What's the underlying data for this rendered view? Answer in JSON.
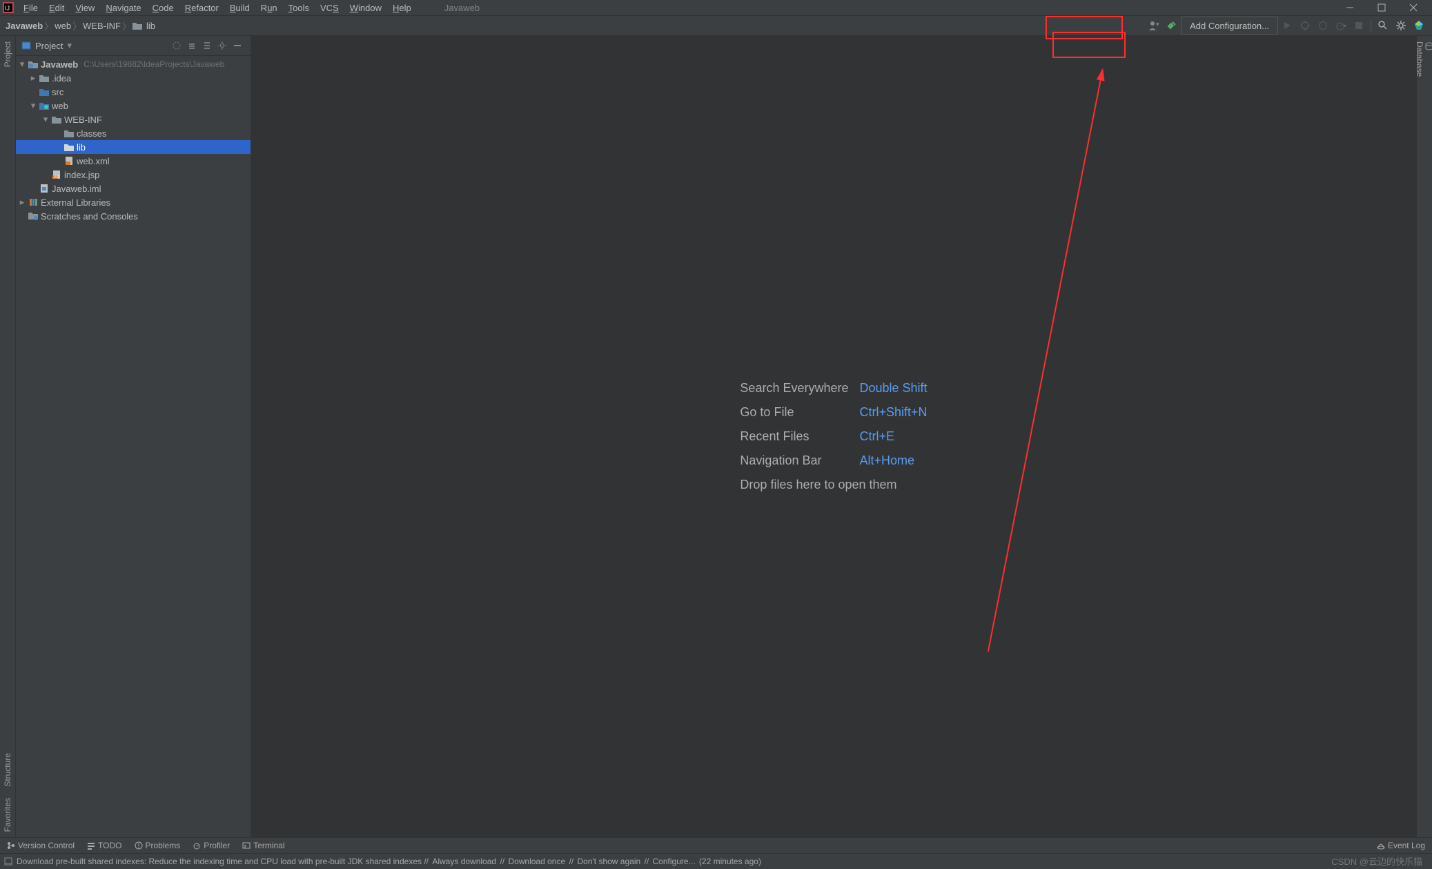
{
  "title": {
    "project": "Javaweb"
  },
  "menu": [
    "File",
    "Edit",
    "View",
    "Navigate",
    "Code",
    "Refactor",
    "Build",
    "Run",
    "Tools",
    "VCS",
    "Window",
    "Help"
  ],
  "breadcrumbs": {
    "items": [
      "Javaweb",
      "web",
      "WEB-INF",
      "lib"
    ]
  },
  "toolbar": {
    "add_config": "Add Configuration..."
  },
  "project_panel": {
    "title": "Project",
    "tree": {
      "root": {
        "name": "Javaweb",
        "path": "C:\\Users\\19882\\IdeaProjects\\Javaweb"
      },
      "idea": ".idea",
      "src": "src",
      "web": "web",
      "webinf": "WEB-INF",
      "classes": "classes",
      "lib": "lib",
      "webxml": "web.xml",
      "indexjsp": "index.jsp",
      "iml": "Javaweb.iml",
      "extlib": "External Libraries",
      "scratches": "Scratches and Consoles"
    }
  },
  "editor_hints": {
    "search": {
      "label": "Search Everywhere",
      "key": "Double Shift"
    },
    "goto": {
      "label": "Go to File",
      "key": "Ctrl+Shift+N"
    },
    "recent": {
      "label": "Recent Files",
      "key": "Ctrl+E"
    },
    "navbar": {
      "label": "Navigation Bar",
      "key": "Alt+Home"
    },
    "drop": "Drop files here to open them"
  },
  "left_tabs": {
    "project": "Project",
    "structure": "Structure",
    "favorites": "Favorites"
  },
  "right_tabs": {
    "database": "Database"
  },
  "bottom_tabs": {
    "vcs": "Version Control",
    "todo": "TODO",
    "problems": "Problems",
    "profiler": "Profiler",
    "terminal": "Terminal",
    "eventlog": "Event Log"
  },
  "status": {
    "prefix": "Download pre-built shared indexes: Reduce the indexing time and CPU load with pre-built JDK shared indexes",
    "l1": "Always download",
    "l2": "Download once",
    "l3": "Don't show again",
    "l4": "Configure...",
    "time": "(22 minutes ago)"
  },
  "watermark": "CSDN @云边的快乐猫"
}
